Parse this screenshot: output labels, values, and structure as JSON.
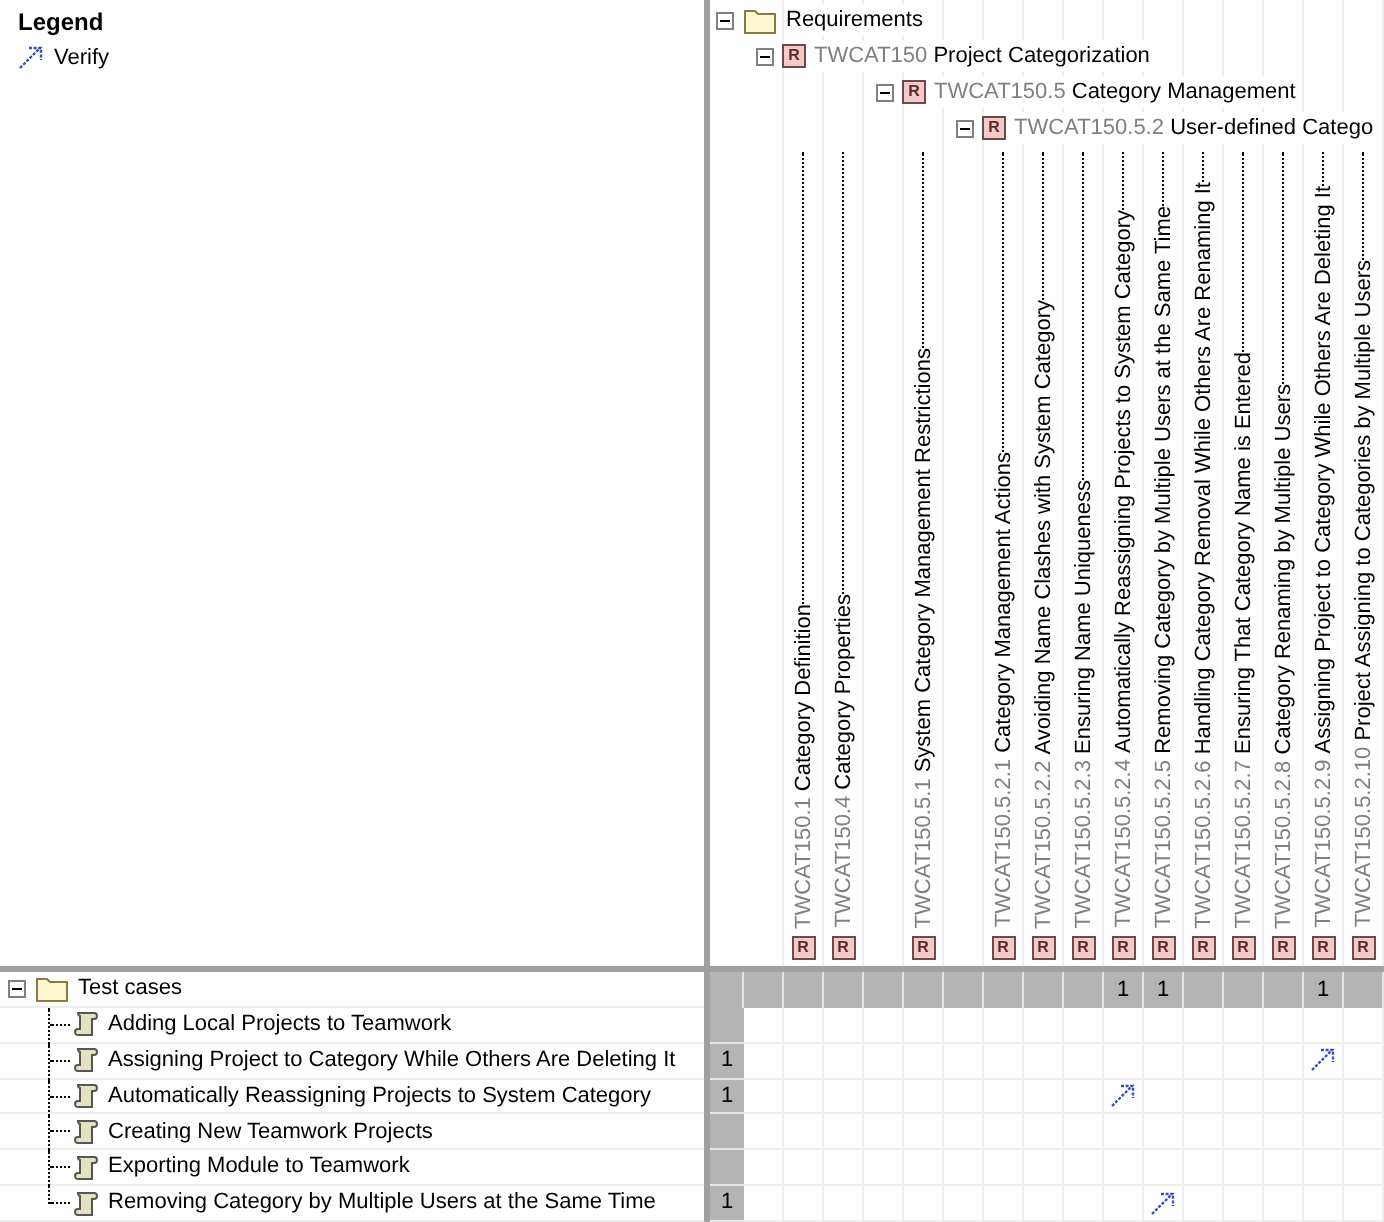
{
  "legend": {
    "title": "Legend",
    "items": [
      {
        "kind": "verify",
        "label": "Verify"
      }
    ]
  },
  "columns_tree": {
    "label": "Requirements",
    "expanded": true,
    "children": [
      {
        "id": "TWCAT150",
        "name": "Project Categorization",
        "badge": "R",
        "expanded": true,
        "children": [
          {
            "id": "TWCAT150.1",
            "name": "Category Definition",
            "badge": "R"
          },
          {
            "id": "TWCAT150.4",
            "name": "Category Properties",
            "badge": "R"
          },
          {
            "id": "TWCAT150.5",
            "name": "Category Management",
            "badge": "R",
            "expanded": true,
            "children": [
              {
                "id": "TWCAT150.5.1",
                "name": "System Category Management Restrictions",
                "badge": "R"
              },
              {
                "id": "TWCAT150.5.2",
                "name": "User-defined Catego",
                "badge": "R",
                "expanded": true,
                "children": [
                  {
                    "id": "TWCAT150.5.2.1",
                    "name": "Category Management Actions",
                    "badge": "R"
                  },
                  {
                    "id": "TWCAT150.5.2.2",
                    "name": "Avoiding Name Clashes with System Category",
                    "badge": "R"
                  },
                  {
                    "id": "TWCAT150.5.2.3",
                    "name": "Ensuring Name Uniqueness",
                    "badge": "R"
                  },
                  {
                    "id": "TWCAT150.5.2.4",
                    "name": "Automatically Reassigning Projects to System Category",
                    "badge": "R",
                    "count": "1"
                  },
                  {
                    "id": "TWCAT150.5.2.5",
                    "name": "Removing Category by Multiple Users at the Same Time",
                    "badge": "R",
                    "count": "1"
                  },
                  {
                    "id": "TWCAT150.5.2.6",
                    "name": "Handling Category Removal While Others Are Renaming It",
                    "badge": "R"
                  },
                  {
                    "id": "TWCAT150.5.2.7",
                    "name": "Ensuring That Category Name is Entered",
                    "badge": "R"
                  },
                  {
                    "id": "TWCAT150.5.2.8",
                    "name": "Category Renaming by Multiple Users",
                    "badge": "R"
                  },
                  {
                    "id": "TWCAT150.5.2.9",
                    "name": "Assigning Project to Category While Others Are Deleting It",
                    "badge": "R",
                    "count": "1"
                  },
                  {
                    "id": "TWCAT150.5.2.10",
                    "name": "Project Assigning to Categories by Multiple Users",
                    "badge": "R"
                  }
                ]
              }
            ]
          }
        ]
      }
    ]
  },
  "rows_tree": {
    "label": "Test cases",
    "expanded": true,
    "children": [
      {
        "name": "Adding Local Projects to Teamwork",
        "verify": [
          false,
          false,
          false,
          false,
          false,
          false,
          false,
          false,
          false,
          false,
          false,
          false,
          false,
          false,
          false,
          false
        ]
      },
      {
        "name": "Assigning Project to Category While Others Are Deleting It",
        "count": "1",
        "verify": [
          false,
          false,
          false,
          false,
          false,
          false,
          false,
          false,
          false,
          false,
          false,
          false,
          false,
          false,
          true,
          false
        ]
      },
      {
        "name": "Automatically Reassigning Projects to System Category",
        "count": "1",
        "verify": [
          false,
          false,
          false,
          false,
          false,
          false,
          false,
          false,
          false,
          true,
          false,
          false,
          false,
          false,
          false,
          false
        ]
      },
      {
        "name": "Creating New Teamwork Projects",
        "verify": [
          false,
          false,
          false,
          false,
          false,
          false,
          false,
          false,
          false,
          false,
          false,
          false,
          false,
          false,
          false,
          false
        ]
      },
      {
        "name": "Exporting Module to Teamwork",
        "verify": [
          false,
          false,
          false,
          false,
          false,
          false,
          false,
          false,
          false,
          false,
          false,
          false,
          false,
          false,
          false,
          false
        ]
      },
      {
        "name": "Removing Category by Multiple Users at the Same Time",
        "count": "1",
        "verify": [
          false,
          false,
          false,
          false,
          false,
          false,
          false,
          false,
          false,
          false,
          true,
          false,
          false,
          false,
          false,
          false
        ]
      }
    ]
  }
}
